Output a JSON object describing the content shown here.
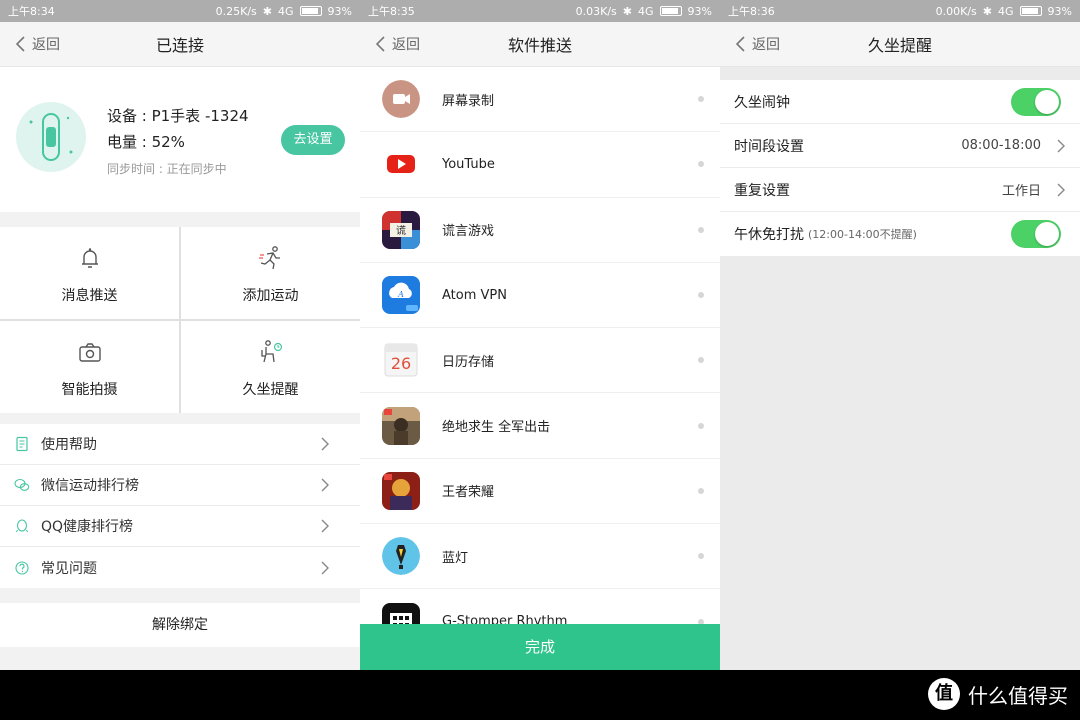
{
  "panel1": {
    "status": {
      "time": "上午8:34",
      "speed": "0.25K/s",
      "network": "4G",
      "battery": "93%"
    },
    "header": {
      "back": "返回",
      "title": "已连接"
    },
    "device": {
      "name": "设备 : P1手表 -1324",
      "battery": "电量 : 52%",
      "sync": "同步时间 : 正在同步中",
      "setup_button": "去设置"
    },
    "grid": [
      {
        "label": "消息推送",
        "icon": "bell-icon"
      },
      {
        "label": "添加运动",
        "icon": "running-icon"
      },
      {
        "label": "智能拍摄",
        "icon": "camera-icon"
      },
      {
        "label": "久坐提醒",
        "icon": "sitting-icon"
      }
    ],
    "list": [
      {
        "label": "使用帮助",
        "icon": "document-icon"
      },
      {
        "label": "微信运动排行榜",
        "icon": "wechat-icon"
      },
      {
        "label": "QQ健康排行榜",
        "icon": "qq-icon"
      },
      {
        "label": "常见问题",
        "icon": "question-icon"
      }
    ],
    "unbind": "解除绑定"
  },
  "panel2": {
    "status": {
      "time": "上午8:35",
      "speed": "0.03K/s",
      "network": "4G",
      "battery": "93%"
    },
    "header": {
      "back": "返回",
      "title": "软件推送"
    },
    "apps": [
      {
        "name": "屏幕录制",
        "icon": "screen-record-icon"
      },
      {
        "name": "YouTube",
        "icon": "youtube-icon"
      },
      {
        "name": "谎言游戏",
        "icon": "lie-game-icon"
      },
      {
        "name": "Atom VPN",
        "icon": "vpn-icon"
      },
      {
        "name": "日历存储",
        "icon": "calendar-icon"
      },
      {
        "name": "绝地求生 全军出击",
        "icon": "pubg-icon"
      },
      {
        "name": "王者荣耀",
        "icon": "honor-of-kings-icon"
      },
      {
        "name": "蓝灯",
        "icon": "lantern-icon"
      },
      {
        "name": "G-Stomper Rhythm",
        "icon": "g-stomper-icon"
      }
    ],
    "calendar_day": "26",
    "done_button": "完成"
  },
  "panel3": {
    "status": {
      "time": "上午8:36",
      "speed": "0.00K/s",
      "network": "4G",
      "battery": "93%"
    },
    "header": {
      "back": "返回",
      "title": "久坐提醒"
    },
    "rows": [
      {
        "label": "久坐闹钟",
        "toggle": true
      },
      {
        "label": "时间段设置",
        "value": "08:00-18:00"
      },
      {
        "label": "重复设置",
        "value": "工作日"
      },
      {
        "label": "午休免打扰",
        "note": "(12:00-14:00不提醒)",
        "toggle": true
      }
    ]
  },
  "watermark": {
    "logo": "值",
    "text": "什么值得买"
  },
  "colors": {
    "accent": "#48c6a1",
    "done": "#2fc48c",
    "toggle_on": "#4cd167"
  }
}
